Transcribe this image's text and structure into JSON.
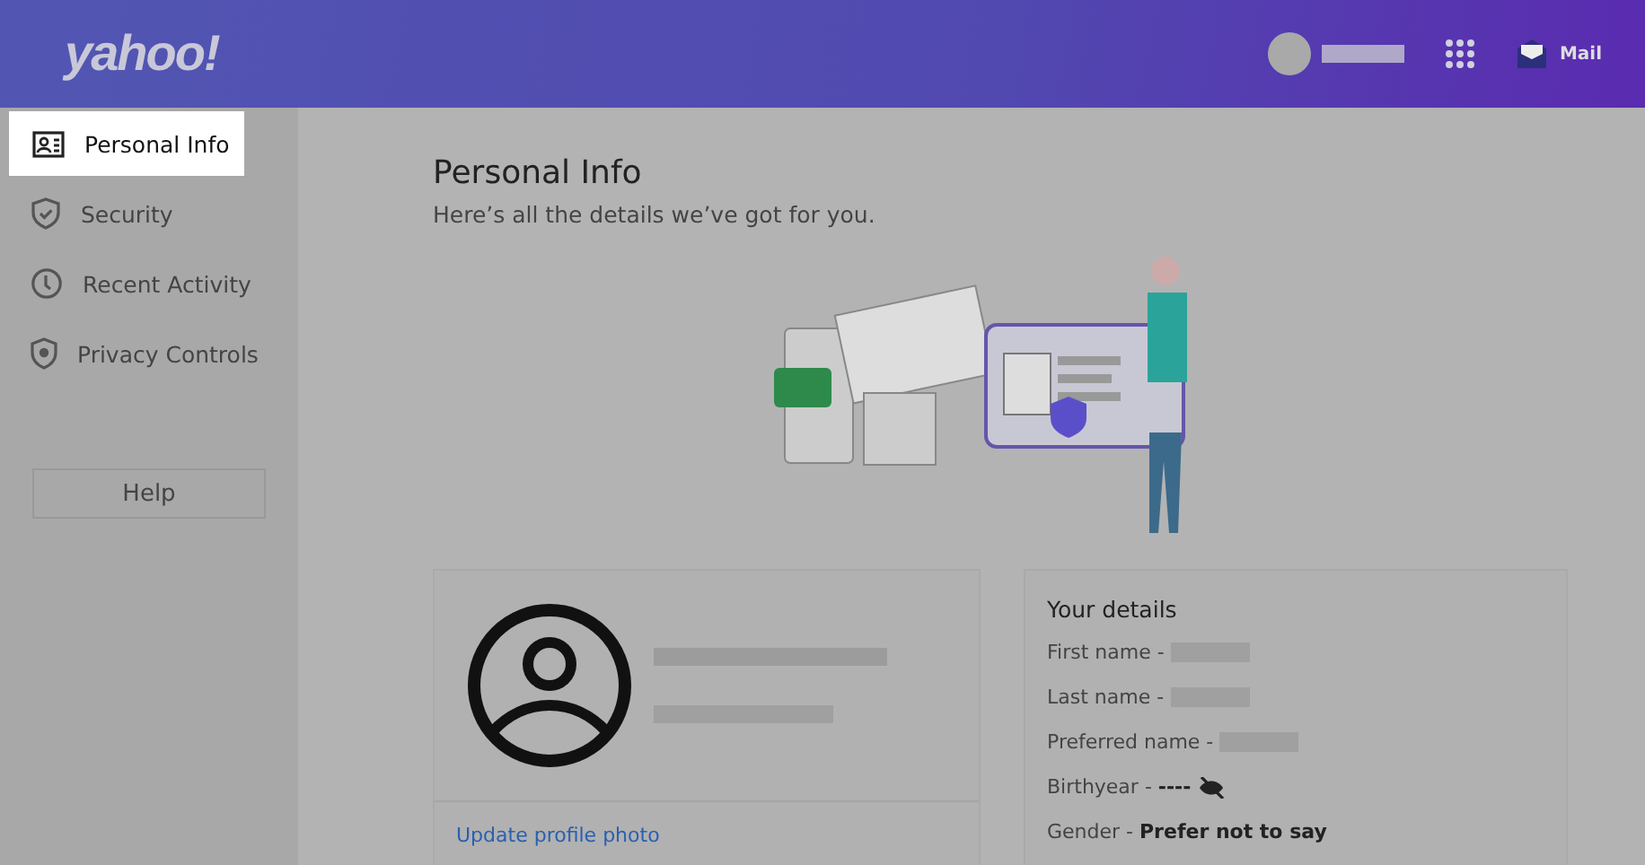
{
  "header": {
    "logo": "yahoo!",
    "mail_label": "Mail"
  },
  "sidebar": {
    "items": [
      {
        "label": "Personal Info",
        "selected": true
      },
      {
        "label": "Security",
        "selected": false
      },
      {
        "label": "Recent Activity",
        "selected": false
      },
      {
        "label": "Privacy Controls",
        "selected": false
      }
    ],
    "help_button": "Help"
  },
  "page": {
    "title": "Personal Info",
    "subtitle": "Here’s all the details we’ve got for you."
  },
  "profile_card": {
    "link": "Update profile photo"
  },
  "details": {
    "title": "Your details",
    "rows": [
      {
        "label": "First name - ",
        "kind": "hidden"
      },
      {
        "label": "Last name - ",
        "kind": "hidden"
      },
      {
        "label": "Preferred name - ",
        "kind": "hidden"
      },
      {
        "text": "Birthyear - **----**",
        "kind": "private"
      },
      {
        "label": "Gender - ",
        "value": "Prefer not to say",
        "kind": "text"
      }
    ]
  }
}
